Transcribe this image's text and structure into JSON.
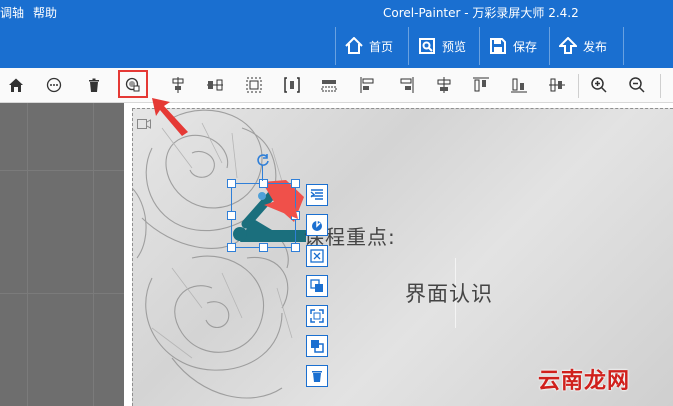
{
  "menu": {
    "item1": "调轴",
    "item2": "帮助"
  },
  "app_title": "Corel-Painter - 万彩录屏大师 2.4.2",
  "top_buttons": {
    "home": "首页",
    "preview": "预览",
    "save": "保存",
    "publish": "发布"
  },
  "toolbar": {
    "icons": [
      "home-icon",
      "more-icon",
      "delete-icon",
      "mask-icon",
      "align-hcenter-icon",
      "distribute-icon",
      "group-icon",
      "bracket-icon",
      "layout-icon",
      "align-left-icon",
      "align-right-icon",
      "align-vcenter-icon",
      "align-top-icon",
      "align-bottom-icon",
      "align-middle-icon",
      "zoom-in-icon",
      "zoom-out-icon"
    ]
  },
  "slide": {
    "title": "课程重点:",
    "subtitle": "界面认识"
  },
  "watermark": "云南龙网",
  "colors": {
    "brand": "#1a6fd0",
    "highlight": "#e53935",
    "teal": "#1b6f7d",
    "coral": "#f0504a"
  }
}
